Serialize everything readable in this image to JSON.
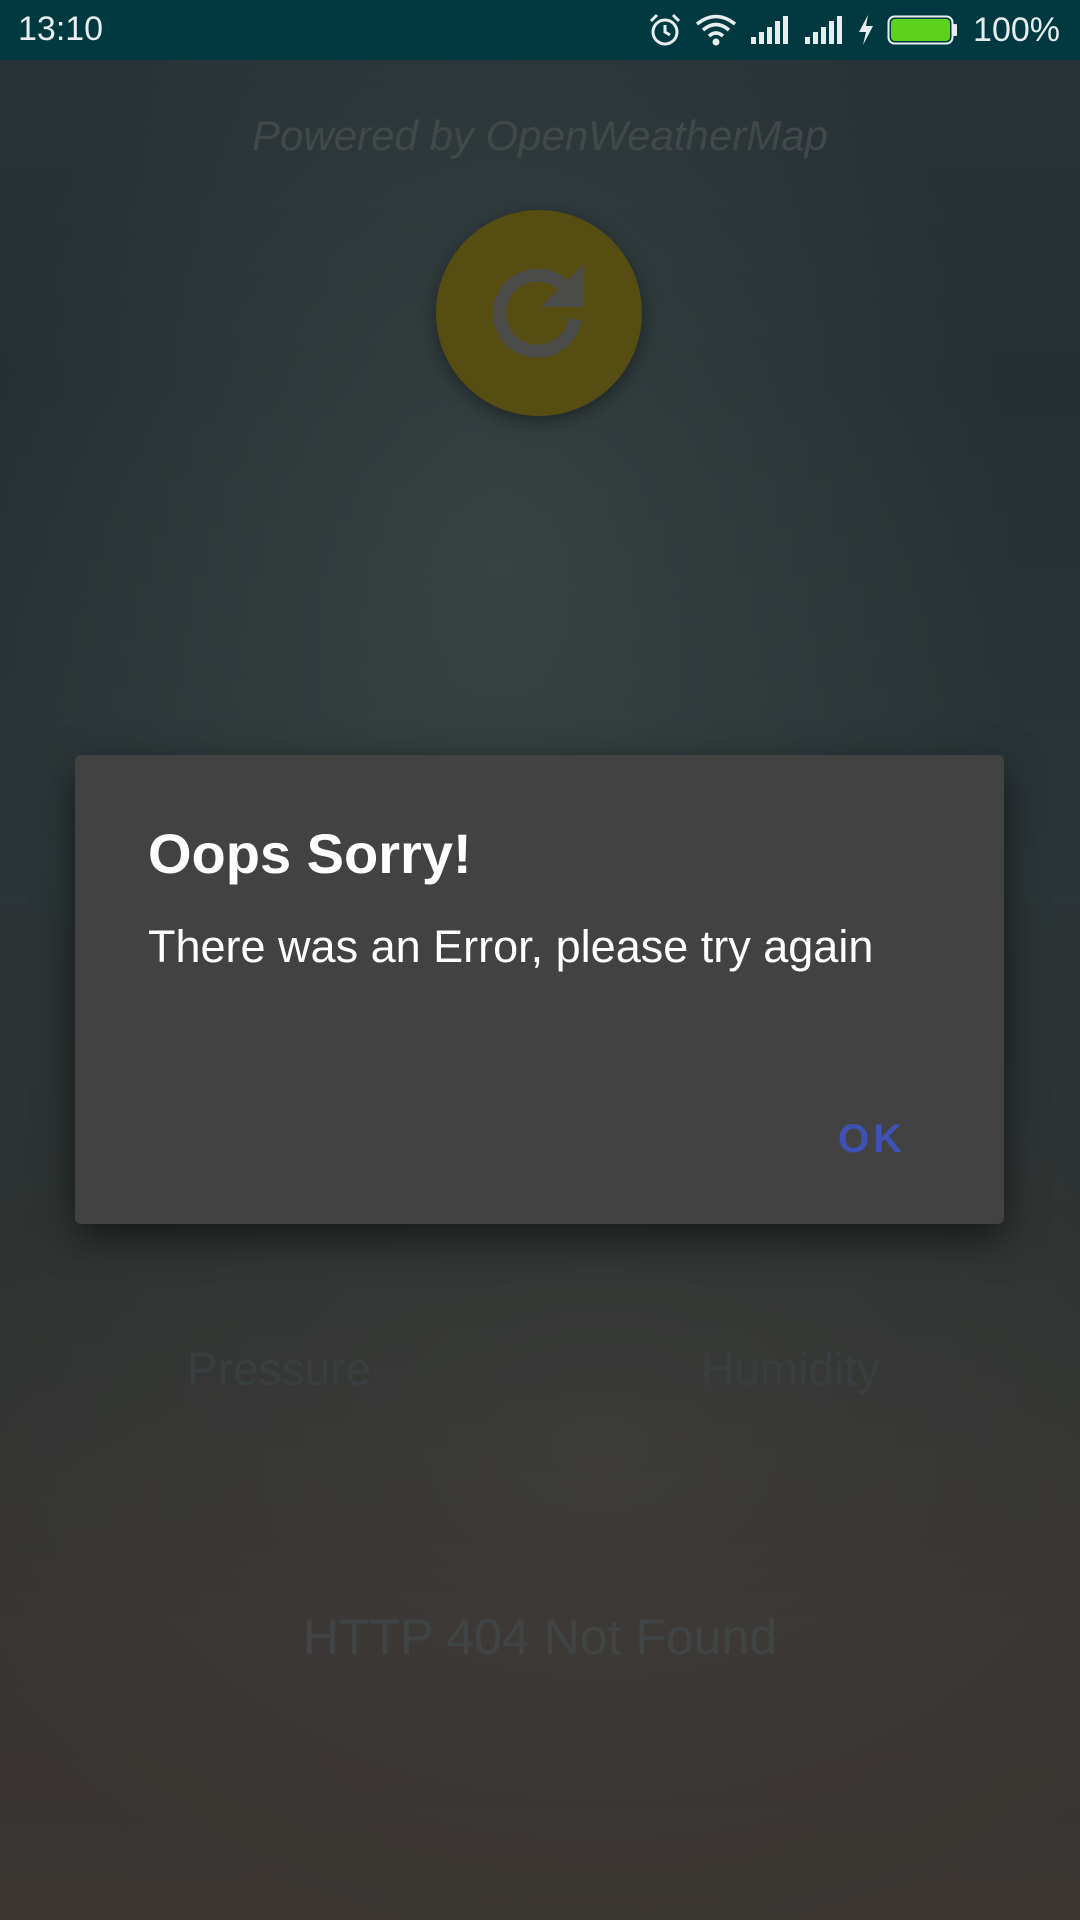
{
  "status_bar": {
    "time": "13:10",
    "battery_percent": "100%",
    "battery_level": 1.0,
    "icons": [
      "alarm-icon",
      "wifi-icon",
      "signal-icon",
      "signal-icon",
      "charging-icon",
      "battery-icon"
    ],
    "battery_color": "#5ed11c"
  },
  "app": {
    "powered_by": "Powered by OpenWeatherMap",
    "refresh_icon": "refresh-icon",
    "refresh_color": "#ffd32a",
    "pressure_label": "Pressure",
    "humidity_label": "Humidity",
    "error_status": "HTTP 404 Not Found"
  },
  "dialog": {
    "title": "Oops Sorry!",
    "message": "There was an Error, please try again",
    "ok_label": "OK",
    "accent": "#3f51b5"
  }
}
